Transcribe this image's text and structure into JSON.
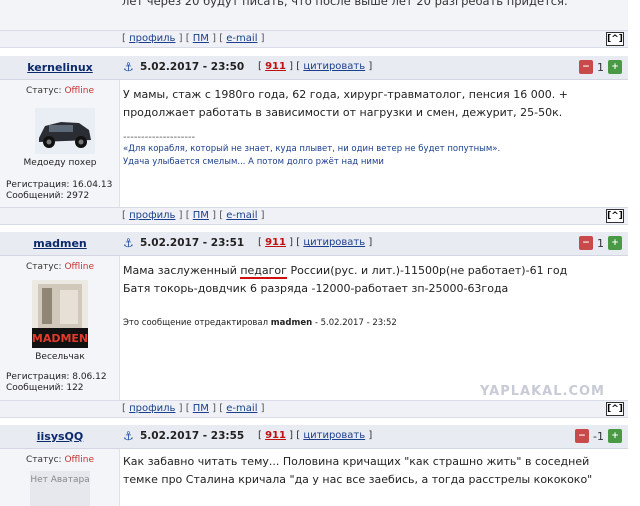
{
  "prev_post": {
    "tail_text": "лет через 20 будут писать, что после выше лет 20 разгребать придется."
  },
  "footer": {
    "profile": "профиль",
    "pm": "ПМ",
    "email": "e-mail",
    "up": "[^]"
  },
  "posts": [
    {
      "nick": "kernelinux",
      "date": "5.02.2017 - 23:50",
      "num": "911",
      "quote": "цитировать",
      "score": "1",
      "status_label": "Статус:",
      "status": "Offline",
      "caption": "Медоеду похер",
      "reg": "Регистрация: 16.04.13",
      "msgs": "Сообщений: 2972",
      "text": "У мамы, стаж с 1980го года, 62 года, хирург-травматолог, пенсия 16 000. + продолжает работать в зависимости от нагрузки и смен, дежурит, 25-50к.",
      "sig_line": "--------------------",
      "sig1": "«Для корабля, который не знает, куда плывет, ни один ветер не будет попутным».",
      "sig2": "Удача улыбается смелым... А потом долго ржёт над ними"
    },
    {
      "nick": "madmen",
      "date": "5.02.2017 - 23:51",
      "num": "911",
      "quote": "цитировать",
      "score": "1",
      "status_label": "Статус:",
      "status": "Offline",
      "caption": "Весельчак",
      "avatar_text": "MADMEN",
      "reg": "Регистрация: 8.06.12",
      "msgs": "Сообщений: 122",
      "line1_pre": "Мама заслуженный ",
      "line1_mark": "педагог",
      "line1_post": " России(рус. и лит.)-11500р(не работает)-61 год",
      "line2": "Батя токорь-довдчик 6 разряда -12000-работает зп-25000-63года",
      "edit_pre": "Это сообщение отредактировал ",
      "edit_nick": "madmen",
      "edit_post": " - 5.02.2017 - 23:52"
    },
    {
      "nick": "iisysQQ",
      "date": "5.02.2017 - 23:55",
      "num": "911",
      "quote": "цитировать",
      "score": "-1",
      "status_label": "Статус:",
      "status": "Offline",
      "avatar_text": "Нет Аватара",
      "text": "Как забавно читать тему... Половина кричащих \"как страшно жить\" в соседней темке про Сталина кричала \"да у нас все заебись, а тогда расстрелы кокококо\""
    }
  ],
  "watermark": "YAPLAKAL.COM"
}
